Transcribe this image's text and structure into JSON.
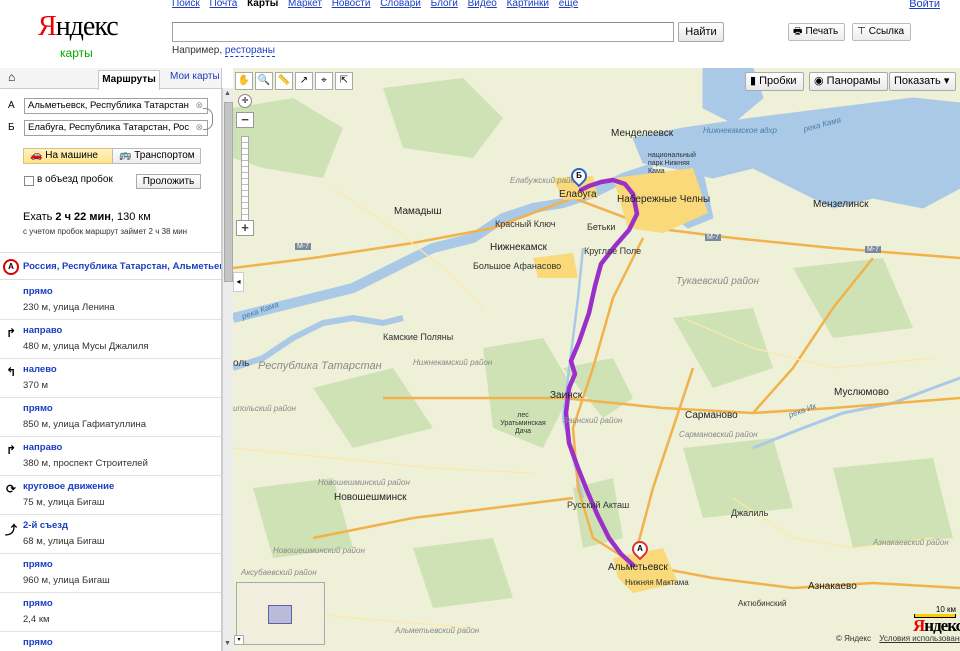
{
  "header": {
    "logo": "Яндекс",
    "logo_sub": "карты",
    "services": [
      "Поиск",
      "Почта",
      "Карты",
      "Маркет",
      "Новости",
      "Словари",
      "Блоги",
      "Видео",
      "Картинки",
      "ещё"
    ],
    "active_service": "Карты",
    "login": "Войти",
    "search_value": "",
    "search_button": "Найти",
    "hint_prefix": "Например,",
    "hint_example": "рестораны",
    "print_label": "Печать",
    "link_label": "Ссылка"
  },
  "panel": {
    "tab_routes": "Маршруты",
    "tab_mymaps": "Мои карты",
    "from_letter": "А",
    "from_value": "Альметьевск, Республика Татарстан",
    "to_letter": "Б",
    "to_value": "Елабуга, Республика Татарстан, Рос",
    "mode_car": "На машине",
    "mode_transit": "Транспортом",
    "avoid_traffic": "в объезд пробок",
    "extend_button": "Проложить",
    "drive_prefix": "Ехать",
    "drive_time": "2 ч 22 мин",
    "drive_distance": ", 130 км",
    "traffic_note": "с учетом пробок маршрут займет 2 ч 38 мин",
    "start_marker": "А",
    "start_text": "Россия, Республика Татарстан, Альметьевск",
    "steps": [
      {
        "icon": "straight-icon",
        "glyph": "",
        "title": "прямо",
        "detail": "230 м, улица Ленина"
      },
      {
        "icon": "turn-right-icon",
        "glyph": "↱",
        "title": "направо",
        "detail": "480 м, улица Мусы Джалиля"
      },
      {
        "icon": "turn-left-icon",
        "glyph": "↰",
        "title": "налево",
        "detail": "370 м"
      },
      {
        "icon": "straight-icon",
        "glyph": "",
        "title": "прямо",
        "detail": "850 м, улица Гафиатуллина"
      },
      {
        "icon": "turn-right-icon",
        "glyph": "↱",
        "title": "направо",
        "detail": "380 м, проспект Строителей"
      },
      {
        "icon": "roundabout-icon",
        "glyph": "⟳",
        "title": "круговое движение",
        "detail": "75 м, улица Бигаш"
      },
      {
        "icon": "exit-icon",
        "glyph": "⤴",
        "title": "2-й съезд",
        "detail": "68 м, улица Бигаш"
      },
      {
        "icon": "straight-icon",
        "glyph": "",
        "title": "прямо",
        "detail": "960 м, улица Бигаш"
      },
      {
        "icon": "straight-icon",
        "glyph": "",
        "title": "прямо",
        "detail": "2,4 км"
      },
      {
        "icon": "straight-icon",
        "glyph": "",
        "title": "прямо",
        "detail": ""
      }
    ]
  },
  "map": {
    "btn_traffic": "Пробки",
    "btn_panoramas": "Панорамы",
    "btn_show": "Показать",
    "scale": "10 км",
    "watermark": "Яндекс",
    "copyright": "© Яндекс",
    "terms": "Условия использования",
    "pin_a": "А",
    "pin_b": "Б",
    "labels": {
      "mendeleevsk": "Менделеевск",
      "nizhnekamsk_reservoir": "Нижнекамское вдхр",
      "national_park": "национальный парк Нижняя Кама",
      "elabuga": "Елабуга",
      "naberezhnye_chelny": "Набережные Челны",
      "menzelinsk": "Мензелинск",
      "mamadysh": "Мамадыш",
      "elabuga_district": "Елабужский район",
      "krasny_klyuch": "Красный Ключ",
      "betki": "Бетьки",
      "nizhnekamsk": "Нижнекамск",
      "krugloe_pole": "Круглое Поле",
      "bolshoe_afanasovo": "Большое Афанасово",
      "tukaevsky": "Тукаевский район",
      "kamskie_polyany": "Камские Поляны",
      "tatarstan": "Республика Татарстан",
      "nizhnekamsky_district": "Нижнекамский район",
      "zainsk": "Заинск",
      "sarmanovo": "Сарманово",
      "muslyumovo": "Муслюмово",
      "forest_uratma": "лес Уратьминская Дача",
      "zainsky_district": "Заинский район",
      "sarmanovsky_district": "Сармановский район",
      "novosheshminsky_district": "Новошешминский район",
      "novosheshminsk": "Новошешминск",
      "russky_aktash": "Русский Акташ",
      "dzhalil": "Джалиль",
      "almetyevsk": "Альметьевск",
      "nizhnyaya_maktama": "Нижняя Мактама",
      "aznakaevo": "Азнакаево",
      "aktyubinsky": "Актюбинский",
      "almetyevsky_district": "Альметьевский район",
      "aksubaevsky_district": "Аксубаевский район",
      "novosheshminsky_district2": "Новошешминский район",
      "kama_river": "река Кама",
      "ik_river": "река Ик",
      "kama_river2": "река Кама",
      "aznakaevsky_district": "Азнакаевский район",
      "cut_ol": "оль",
      "cut_district": "ипольский район",
      "m7": "М-7",
      "m7b": "М-7",
      "m7c": "М-7"
    }
  },
  "colors": {
    "route": "#9b30c9",
    "water": "#a9c9e6",
    "forest": "#c8deb0",
    "land": "#eef0d8",
    "yandex_red": "#ee0000"
  }
}
